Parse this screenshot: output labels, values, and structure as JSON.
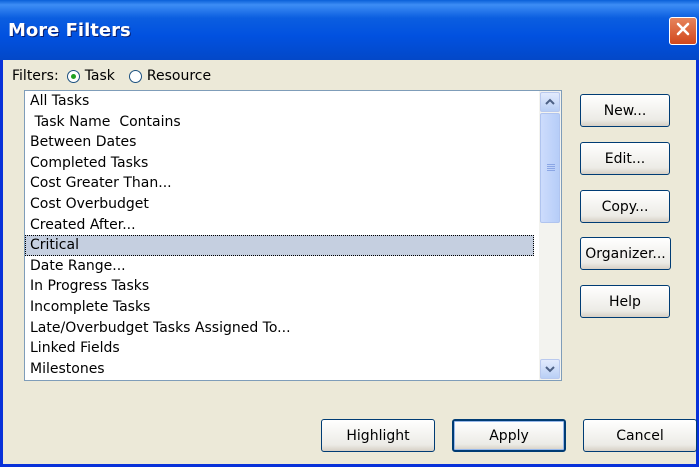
{
  "window": {
    "title": "More Filters"
  },
  "filters": {
    "label": "Filters:",
    "options": [
      {
        "label": "Task",
        "checked": true
      },
      {
        "label": "Resource",
        "checked": false
      }
    ]
  },
  "filter_list": {
    "items": [
      "All Tasks",
      " Task Name  Contains",
      "Between Dates",
      "Completed Tasks",
      "Cost Greater Than...",
      "Cost Overbudget",
      "Created After...",
      "Critical",
      "Date Range...",
      "In Progress Tasks",
      "Incomplete Tasks",
      "Late/Overbudget Tasks Assigned To...",
      "Linked Fields",
      "Milestones"
    ],
    "selected_index": 7
  },
  "side_buttons": {
    "new": "New...",
    "edit": "Edit...",
    "copy": "Copy...",
    "organizer": "Organizer...",
    "help": "Help"
  },
  "bottom_buttons": {
    "highlight": "Highlight",
    "apply": "Apply",
    "cancel": "Cancel"
  },
  "icons": {
    "close": "close-icon",
    "scroll_up": "chevron-up-icon",
    "scroll_down": "chevron-down-icon"
  },
  "colors": {
    "titlebar": "#0151e0",
    "selection": "#c5cfe0",
    "close": "#d2471c"
  }
}
